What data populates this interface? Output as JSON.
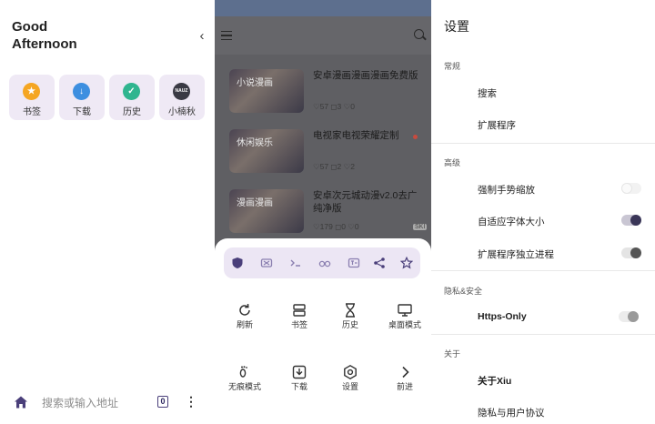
{
  "home": {
    "greeting": "Good\nAfternoon",
    "collapse_glyph": "‹",
    "tiles": [
      {
        "label": "书签",
        "icon": "bookmark-star-icon",
        "color": "#f5a623",
        "glyph": "★"
      },
      {
        "label": "下载",
        "icon": "download-icon",
        "color": "#3d8fe0",
        "glyph": "↓"
      },
      {
        "label": "历史",
        "icon": "history-leaf-icon",
        "color": "#2fb58f",
        "glyph": "✓"
      },
      {
        "label": "小楠秋",
        "icon": "site-logo-icon",
        "color": "#3a3a44",
        "glyph": "NAUZ"
      }
    ],
    "address_placeholder": "搜索或输入地址",
    "tab_count": "0",
    "menu_glyph": "⋮"
  },
  "browser": {
    "feed": [
      {
        "tag": "小说漫画",
        "title": "安卓漫画漫画漫画免费版",
        "meta": "♡57 ◻3 ♡0",
        "has_dot": false,
        "badge": ""
      },
      {
        "tag": "休闲娱乐",
        "title": "电视家电视荣耀定制",
        "meta": "♡57 ◻2 ♡2",
        "has_dot": true,
        "badge": ""
      },
      {
        "tag": "漫画漫画",
        "title": "安卓次元城动漫v2.0去广纯净版",
        "meta": "♡179 ◻0 ♡0",
        "has_dot": false,
        "badge": "SKI"
      }
    ],
    "quick_actions": [
      "shield-icon",
      "ad-block-icon",
      "script-icon",
      "glasses-icon",
      "translate-icon",
      "share-icon",
      "star-icon"
    ],
    "menu": [
      {
        "label": "刷新",
        "icon": "refresh-icon"
      },
      {
        "label": "书签",
        "icon": "bookmarks-icon"
      },
      {
        "label": "历史",
        "icon": "hourglass-icon"
      },
      {
        "label": "桌面模式",
        "icon": "desktop-icon"
      },
      {
        "label": "无痕模式",
        "icon": "footprint-icon"
      },
      {
        "label": "下载",
        "icon": "download-tray-icon"
      },
      {
        "label": "设置",
        "icon": "settings-hex-icon"
      },
      {
        "label": "前进",
        "icon": "forward-chevron-icon"
      }
    ]
  },
  "settings": {
    "title": "设置",
    "sections": [
      {
        "header": "常规",
        "items": [
          {
            "label": "搜索",
            "bold": false,
            "toggle": null
          },
          {
            "label": "扩展程序",
            "bold": false,
            "toggle": null
          }
        ]
      },
      {
        "header": "高级",
        "items": [
          {
            "label": "强制手势缩放",
            "bold": false,
            "toggle": "off"
          },
          {
            "label": "自适应字体大小",
            "bold": false,
            "toggle": "on"
          },
          {
            "label": "扩展程序独立进程",
            "bold": false,
            "toggle": "off"
          }
        ]
      },
      {
        "header": "隐私&安全",
        "items": [
          {
            "label": "Https-Only",
            "bold": true,
            "toggle": "off"
          }
        ]
      },
      {
        "header": "关于",
        "items": [
          {
            "label": "关于Xiu",
            "bold": true,
            "toggle": null
          },
          {
            "label": "隐私与用户协议",
            "bold": false,
            "toggle": null
          }
        ]
      }
    ],
    "accent": "#3a3658",
    "toggle_track_off": "#e4e4e4"
  }
}
